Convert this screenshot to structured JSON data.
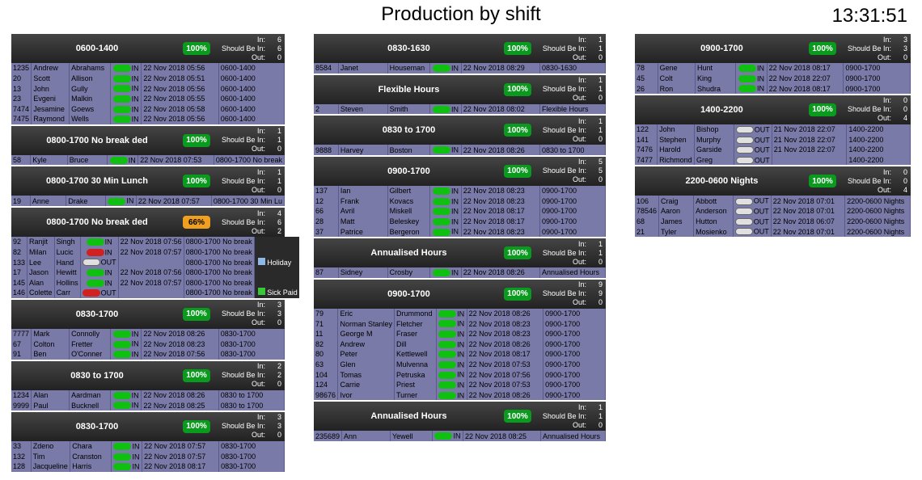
{
  "title": "Production by shift",
  "clock": "13:31:51",
  "labels": {
    "in": "In:",
    "should": "Should Be In:",
    "out": "Out:"
  },
  "legend": {
    "holiday": "Holiday",
    "sick": "Sick Paid"
  },
  "columns": [
    {
      "width": "c1",
      "blocks": [
        {
          "name": "0600-1400",
          "pct": "100%",
          "pct_style": "green",
          "stats": {
            "in": 6,
            "should": 6,
            "out": 0
          },
          "rows": [
            {
              "id": "1235",
              "first": "Andrew",
              "last": "Abrahams",
              "state": "in",
              "time": "22 Nov 2018 05:56",
              "shift": "0600-1400"
            },
            {
              "id": "20",
              "first": "Scott",
              "last": "Allison",
              "state": "in",
              "time": "22 Nov 2018 05:51",
              "shift": "0600-1400"
            },
            {
              "id": "13",
              "first": "John",
              "last": "Gully",
              "state": "in",
              "time": "22 Nov 2018 05:56",
              "shift": "0600-1400"
            },
            {
              "id": "23",
              "first": "Evgeni",
              "last": "Malkin",
              "state": "in",
              "time": "22 Nov 2018 05:55",
              "shift": "0600-1400"
            },
            {
              "id": "7474",
              "first": "Jesamine",
              "last": "Goews",
              "state": "in",
              "time": "22 Nov 2018 05:58",
              "shift": "0600-1400"
            },
            {
              "id": "7475",
              "first": "Raymond",
              "last": "Wells",
              "state": "in",
              "time": "22 Nov 2018 05:56",
              "shift": "0600-1400"
            }
          ]
        },
        {
          "name": "0800-1700 No break ded",
          "pct": "100%",
          "pct_style": "green",
          "stats": {
            "in": 1,
            "should": 1,
            "out": 0
          },
          "rows": [
            {
              "id": "58",
              "first": "Kyle",
              "last": "Bruce",
              "state": "in",
              "time": "22 Nov 2018 07:53",
              "shift": "0800-1700 No break"
            }
          ]
        },
        {
          "name": "0800-1700 30 Min Lunch",
          "pct": "100%",
          "pct_style": "green",
          "stats": {
            "in": 1,
            "should": 1,
            "out": 0
          },
          "rows": [
            {
              "id": "19",
              "first": "Anne",
              "last": "Drake",
              "state": "in",
              "time": "22 Nov 2018 07:57",
              "shift": "0800-1700 30 Min Lu"
            }
          ]
        },
        {
          "name": "0800-1700 No break ded",
          "pct": "66%",
          "pct_style": "orange",
          "stats": {
            "in": 4,
            "should": 6,
            "out": 2
          },
          "rows": [
            {
              "id": "92",
              "first": "Ranjit",
              "last": "Singh",
              "state": "in",
              "time": "22 Nov 2018 07:56",
              "shift": "0800-1700 No break"
            },
            {
              "id": "82",
              "first": "Milan",
              "last": "Lucic",
              "state": "red",
              "time": "22 Nov 2018 07:57",
              "shift": "0800-1700 No break"
            },
            {
              "id": "133",
              "first": "Lee",
              "last": "Hand",
              "state": "out",
              "time": "",
              "shift": "0800-1700 No break",
              "tag": "holiday"
            },
            {
              "id": "17",
              "first": "Jason",
              "last": "Hewitt",
              "state": "in",
              "time": "22 Nov 2018 07:56",
              "shift": "0800-1700 No break"
            },
            {
              "id": "145",
              "first": "Alan",
              "last": "Hollins",
              "state": "in",
              "time": "22 Nov 2018 07:57",
              "shift": "0800-1700 No break"
            },
            {
              "id": "146",
              "first": "Colette",
              "last": "Carr",
              "state": "red",
              "stateTxt": "OUT",
              "time": "",
              "shift": "0800-1700 No break",
              "tag": "sick"
            }
          ]
        },
        {
          "name": "0830-1700",
          "pct": "100%",
          "pct_style": "green",
          "stats": {
            "in": 3,
            "should": 3,
            "out": 0
          },
          "rows": [
            {
              "id": "7777",
              "first": "Mark",
              "last": "Connolly",
              "state": "in",
              "time": "22 Nov 2018 08:26",
              "shift": "0830-1700"
            },
            {
              "id": "67",
              "first": "Colton",
              "last": "Fretter",
              "state": "in",
              "time": "22 Nov 2018 08:23",
              "shift": "0830-1700"
            },
            {
              "id": "91",
              "first": "Ben",
              "last": "O'Conner",
              "state": "in",
              "time": "22 Nov 2018 07:56",
              "shift": "0830-1700"
            }
          ]
        },
        {
          "name": "0830 to 1700",
          "pct": "100%",
          "pct_style": "green",
          "stats": {
            "in": 2,
            "should": 2,
            "out": 0
          },
          "rows": [
            {
              "id": "1234",
              "first": "Alan",
              "last": "Aardman",
              "state": "in",
              "time": "22 Nov 2018 08:26",
              "shift": "0830 to 1700"
            },
            {
              "id": "9999",
              "first": "Paul",
              "last": "Bucknell",
              "state": "in",
              "time": "22 Nov 2018 08:25",
              "shift": "0830 to 1700"
            }
          ]
        },
        {
          "name": "0830-1700",
          "pct": "100%",
          "pct_style": "green",
          "stats": {
            "in": 3,
            "should": 3,
            "out": 0
          },
          "rows": [
            {
              "id": "33",
              "first": "Zdeno",
              "last": "Chara",
              "state": "in",
              "time": "22 Nov 2018 07:57",
              "shift": "0830-1700"
            },
            {
              "id": "132",
              "first": "Tim",
              "last": "Cranston",
              "state": "in",
              "time": "22 Nov 2018 07:57",
              "shift": "0830-1700"
            },
            {
              "id": "128",
              "first": "Jacqueline",
              "last": "Harris",
              "state": "in",
              "time": "22 Nov 2018 08:17",
              "shift": "0830-1700"
            }
          ]
        }
      ]
    },
    {
      "width": "c2",
      "blocks": [
        {
          "name": "0830-1630",
          "pct": "100%",
          "pct_style": "green",
          "stats": {
            "in": 1,
            "should": 1,
            "out": 0
          },
          "rows": [
            {
              "id": "8584",
              "first": "Janet",
              "last": "Houseman",
              "state": "in",
              "time": "22 Nov 2018 08:29",
              "shift": "0830-1630"
            }
          ]
        },
        {
          "name": "Flexible Hours",
          "pct": "100%",
          "pct_style": "green",
          "stats": {
            "in": 1,
            "should": 1,
            "out": 0
          },
          "rows": [
            {
              "id": "2",
              "first": "Steven",
              "last": "Smith",
              "state": "in",
              "time": "22 Nov 2018 08:02",
              "shift": "Flexible Hours"
            }
          ]
        },
        {
          "name": "0830 to 1700",
          "pct": "100%",
          "pct_style": "green",
          "stats": {
            "in": 1,
            "should": 1,
            "out": 0
          },
          "rows": [
            {
              "id": "9888",
              "first": "Harvey",
              "last": "Boston",
              "state": "in",
              "time": "22 Nov 2018 08:26",
              "shift": "0830 to 1700"
            }
          ]
        },
        {
          "name": "0900-1700",
          "pct": "100%",
          "pct_style": "green",
          "stats": {
            "in": 5,
            "should": 5,
            "out": 0
          },
          "rows": [
            {
              "id": "137",
              "first": "Ian",
              "last": "Gilbert",
              "state": "in",
              "time": "22 Nov 2018 08:23",
              "shift": "0900-1700"
            },
            {
              "id": "12",
              "first": "Frank",
              "last": "Kovacs",
              "state": "in",
              "time": "22 Nov 2018 08:23",
              "shift": "0900-1700"
            },
            {
              "id": "66",
              "first": "Avril",
              "last": "Miskell",
              "state": "in",
              "time": "22 Nov 2018 08:17",
              "shift": "0900-1700"
            },
            {
              "id": "28",
              "first": "Matt",
              "last": "Beleskey",
              "state": "in",
              "time": "22 Nov 2018 08:17",
              "shift": "0900-1700"
            },
            {
              "id": "37",
              "first": "Patrice",
              "last": "Bergeron",
              "state": "in",
              "time": "22 Nov 2018 08:23",
              "shift": "0900-1700"
            }
          ]
        },
        {
          "name": "Annualised Hours",
          "pct": "100%",
          "pct_style": "green",
          "stats": {
            "in": 1,
            "should": 1,
            "out": 0
          },
          "rows": [
            {
              "id": "87",
              "first": "Sidney",
              "last": "Crosby",
              "state": "in",
              "time": "22 Nov 2018 08:26",
              "shift": "Annualised Hours"
            }
          ]
        },
        {
          "name": "0900-1700",
          "pct": "100%",
          "pct_style": "green",
          "stats": {
            "in": 9,
            "should": 9,
            "out": 0
          },
          "rows": [
            {
              "id": "79",
              "first": "Eric",
              "last": "Drummond",
              "state": "in",
              "time": "22 Nov 2018 08:26",
              "shift": "0900-1700"
            },
            {
              "id": "71",
              "first": "Norman Stanley",
              "last": "Fletcher",
              "state": "in",
              "time": "22 Nov 2018 08:23",
              "shift": "0900-1700"
            },
            {
              "id": "11",
              "first": "George M",
              "last": "Fraser",
              "state": "in",
              "time": "22 Nov 2018 08:23",
              "shift": "0900-1700"
            },
            {
              "id": "82",
              "first": "Andrew",
              "last": "Dill",
              "state": "in",
              "time": "22 Nov 2018 08:26",
              "shift": "0900-1700"
            },
            {
              "id": "80",
              "first": "Peter",
              "last": "Kettlewell",
              "state": "in",
              "time": "22 Nov 2018 08:17",
              "shift": "0900-1700"
            },
            {
              "id": "63",
              "first": "Glen",
              "last": "Mulvenna",
              "state": "in",
              "time": "22 Nov 2018 07:53",
              "shift": "0900-1700"
            },
            {
              "id": "104",
              "first": "Tomas",
              "last": "Petruska",
              "state": "in",
              "time": "22 Nov 2018 07:56",
              "shift": "0900-1700"
            },
            {
              "id": "124",
              "first": "Carrie",
              "last": "Priest",
              "state": "in",
              "time": "22 Nov 2018 07:53",
              "shift": "0900-1700"
            },
            {
              "id": "98676",
              "first": "Ivor",
              "last": "Turner",
              "state": "in",
              "time": "22 Nov 2018 08:26",
              "shift": "0900-1700"
            }
          ]
        },
        {
          "name": "Annualised Hours",
          "pct": "100%",
          "pct_style": "green",
          "stats": {
            "in": 1,
            "should": 1,
            "out": 0
          },
          "rows": [
            {
              "id": "235689",
              "first": "Ann",
              "last": "Yewell",
              "state": "in",
              "time": "22 Nov 2018 08:25",
              "shift": "Annualised Hours"
            }
          ]
        }
      ]
    },
    {
      "width": "c3",
      "blocks": [
        {
          "name": "0900-1700",
          "pct": "100%",
          "pct_style": "green",
          "stats": {
            "in": 3,
            "should": 3,
            "out": 0
          },
          "rows": [
            {
              "id": "78",
              "first": "Gene",
              "last": "Hunt",
              "state": "in",
              "time": "22 Nov 2018 08:17",
              "shift": "0900-1700"
            },
            {
              "id": "45",
              "first": "Colt",
              "last": "King",
              "state": "in",
              "time": "22 Nov 2018 22:07",
              "shift": "0900-1700"
            },
            {
              "id": "26",
              "first": "Ron",
              "last": "Shudra",
              "state": "in",
              "time": "22 Nov 2018 08:17",
              "shift": "0900-1700"
            }
          ]
        },
        {
          "name": "1400-2200",
          "pct": "100%",
          "pct_style": "green",
          "stats": {
            "in": 0,
            "should": 0,
            "out": 4
          },
          "rows": [
            {
              "id": "122",
              "first": "John",
              "last": "Bishop",
              "state": "out",
              "time": "21 Nov 2018 22:07",
              "shift": "1400-2200"
            },
            {
              "id": "141",
              "first": "Stephen",
              "last": "Murphy",
              "state": "out",
              "time": "21 Nov 2018 22:07",
              "shift": "1400-2200"
            },
            {
              "id": "7476",
              "first": "Harold",
              "last": "Garside",
              "state": "out",
              "time": "21 Nov 2018 22:07",
              "shift": "1400-2200"
            },
            {
              "id": "7477",
              "first": "Richmond",
              "last": "Greg",
              "state": "out",
              "time": "",
              "shift": "1400-2200"
            }
          ]
        },
        {
          "name": "2200-0600 Nights",
          "pct": "100%",
          "pct_style": "green",
          "stats": {
            "in": 0,
            "should": 0,
            "out": 4
          },
          "rows": [
            {
              "id": "106",
              "first": "Craig",
              "last": "Abbott",
              "state": "out",
              "time": "22 Nov 2018 07:01",
              "shift": "2200-0600 Nights"
            },
            {
              "id": "78546",
              "first": "Aaron",
              "last": "Anderson",
              "state": "out",
              "time": "22 Nov 2018 07:01",
              "shift": "2200-0600 Nights"
            },
            {
              "id": "68",
              "first": "James",
              "last": "Hutton",
              "state": "out",
              "time": "22 Nov 2018 06:07",
              "shift": "2200-0600 Nights"
            },
            {
              "id": "21",
              "first": "Tyler",
              "last": "Mosienko",
              "state": "out",
              "time": "22 Nov 2018 07:01",
              "shift": "2200-0600 Nights"
            }
          ]
        }
      ]
    }
  ]
}
